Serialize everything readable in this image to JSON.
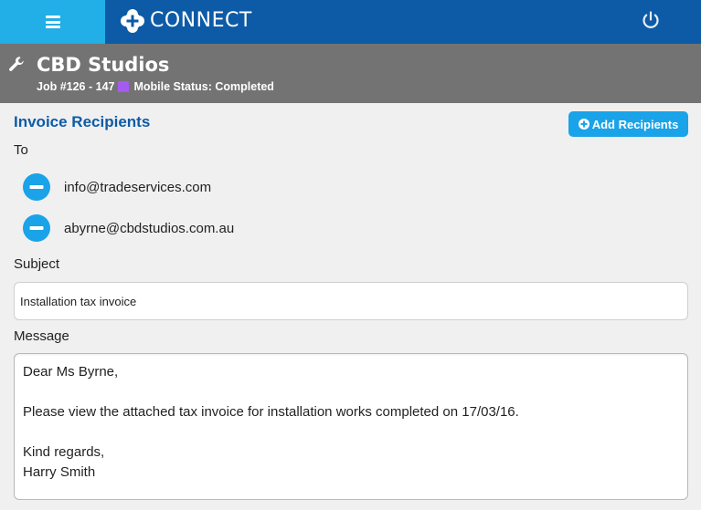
{
  "app": {
    "brand_name": "CONNECT",
    "colors": {
      "topbar": "#0d5ba6",
      "menu_button": "#22aee6",
      "header_bar": "#737373",
      "accent": "#1aa3e8",
      "section_title": "#0d5ba6",
      "status_swatch": "#a55af0"
    },
    "icons": {
      "menu": "hamburger-menu-icon",
      "logo": "plus-cross-logo",
      "power": "power-icon",
      "wrench": "wrench-icon",
      "add": "plus-circle-icon",
      "remove": "minus-circle-icon"
    }
  },
  "job": {
    "title": "CBD Studios",
    "number": "Job #126 - 147",
    "mobile_status": "Mobile Status: Completed"
  },
  "invoice": {
    "section_title": "Invoice Recipients",
    "add_button_label": "Add Recipients",
    "to_label": "To",
    "recipients": [
      "info@tradeservices.com",
      "abyrne@cbdstudios.com.au"
    ],
    "subject_label": "Subject",
    "subject_value": "Installation tax invoice",
    "message_label": "Message",
    "message_lines": [
      "Dear Ms Byrne,",
      "",
      "Please view the attached tax invoice for installation works completed on 17/03/16.",
      "",
      "Kind regards,",
      "Harry Smith"
    ]
  }
}
